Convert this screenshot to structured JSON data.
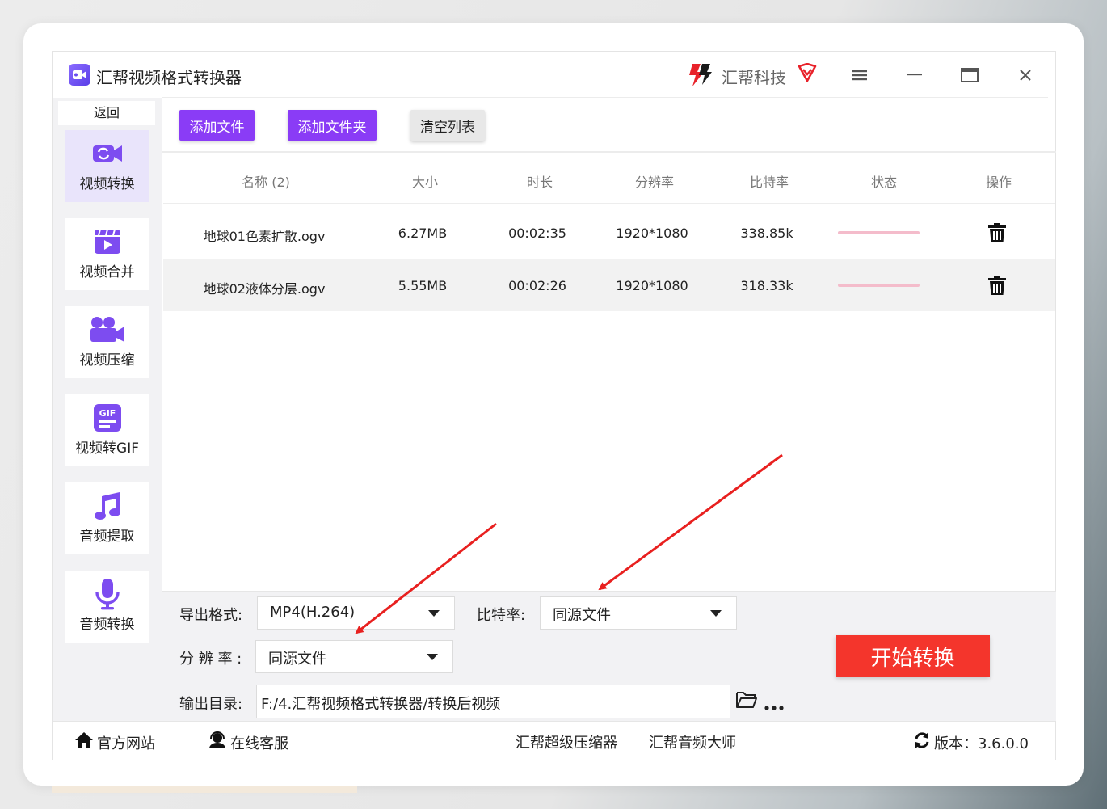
{
  "window": {
    "title": "汇帮视频格式转换器",
    "brand": "汇帮科技"
  },
  "sidebar": {
    "back_label": "返回",
    "items": [
      {
        "label": "视频转换",
        "icon": "video-convert-icon",
        "active": true
      },
      {
        "label": "视频合并",
        "icon": "video-merge-icon"
      },
      {
        "label": "视频压缩",
        "icon": "video-compress-icon"
      },
      {
        "label": "视频转GIF",
        "icon": "gif-icon"
      },
      {
        "label": "音频提取",
        "icon": "music-note-icon"
      },
      {
        "label": "音频转换",
        "icon": "microphone-icon"
      }
    ]
  },
  "toolbar": {
    "add_file": "添加文件",
    "add_folder": "添加文件夹",
    "clear_list": "清空列表"
  },
  "table": {
    "headers": [
      "名称 (2)",
      "大小",
      "时长",
      "分辨率",
      "比特率",
      "状态",
      "操作"
    ],
    "rows": [
      {
        "name": "地球01色素扩散.ogv",
        "size": "6.27MB",
        "duration": "00:02:35",
        "resolution": "1920*1080",
        "bitrate": "338.85k"
      },
      {
        "name": "地球02液体分层.ogv",
        "size": "5.55MB",
        "duration": "00:02:26",
        "resolution": "1920*1080",
        "bitrate": "318.33k"
      }
    ]
  },
  "settings": {
    "format_label": "导出格式:",
    "format_value": "MP4(H.264)",
    "bitrate_label": "比特率:",
    "bitrate_value": "同源文件",
    "resolution_label": "分 辨 率 :",
    "resolution_value": "同源文件",
    "output_label": "输出目录:",
    "output_path": "F:/4.汇帮视频格式转换器/转换后视频",
    "start_button": "开始转换"
  },
  "footer": {
    "website": "官方网站",
    "support": "在线客服",
    "link1": "汇帮超级压缩器",
    "link2": "汇帮音频大师",
    "version": "版本：3.6.0.0"
  },
  "colors": {
    "accent": "#8a3cf6",
    "start": "#f4352c",
    "status_bar": "#f4bccb",
    "sidebar_active": "#e9e4fb"
  }
}
